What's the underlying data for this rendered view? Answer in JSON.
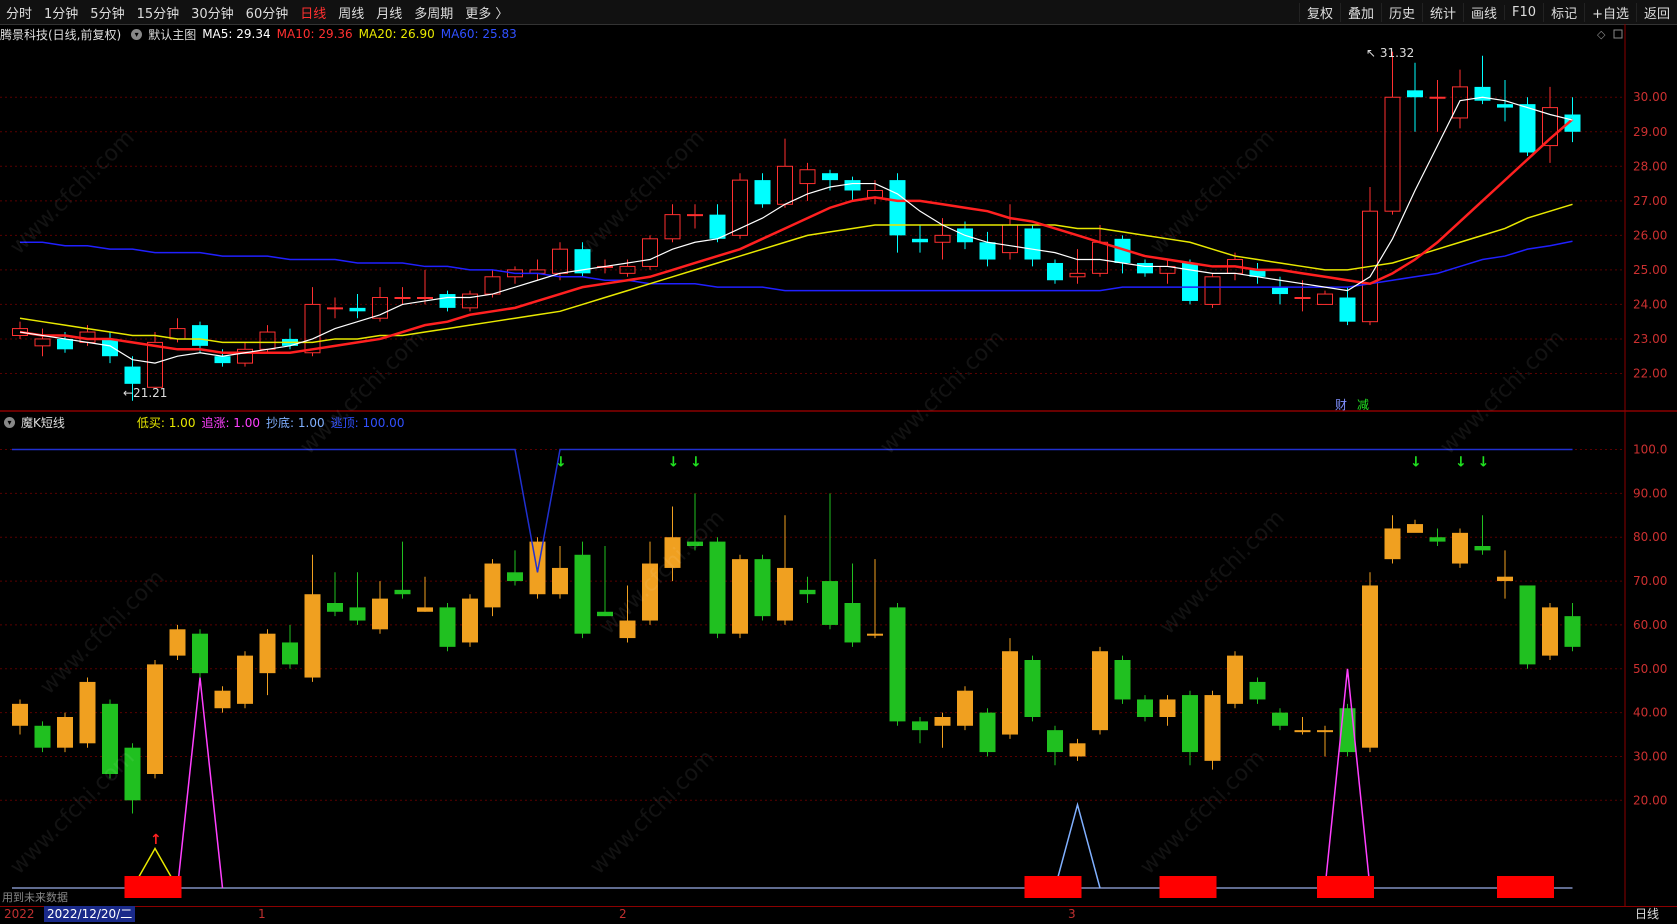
{
  "toolbar": {
    "periods": [
      "分时",
      "1分钟",
      "5分钟",
      "15分钟",
      "30分钟",
      "60分钟",
      "日线",
      "周线",
      "月线",
      "多周期",
      "更多 〉"
    ],
    "active_period": "日线",
    "right_items": [
      "复权",
      "叠加",
      "历史",
      "统计",
      "画线",
      "F10",
      "标记",
      "+自选",
      "返回"
    ]
  },
  "main_info": {
    "stock": "腾景科技(日线,前复权)",
    "template": "默认主图",
    "ma5": "MA5: 29.34",
    "ma10": "MA10: 29.36",
    "ma20": "MA20: 26.90",
    "ma60": "MA60: 25.83"
  },
  "sub_info": {
    "name": "魔K短线",
    "low_buy": "低买: 1.00",
    "chase": "追涨: 1.00",
    "bottom": "抄底: 1.00",
    "top": "逃顶: 100.00"
  },
  "price_axis": [
    "30.00",
    "29.00",
    "28.00",
    "27.00",
    "26.00",
    "25.00",
    "24.00",
    "23.00",
    "22.00"
  ],
  "osc_axis": [
    "100.0",
    "90.00",
    "80.00",
    "70.00",
    "60.00",
    "50.00",
    "40.00",
    "30.00",
    "20.00"
  ],
  "annotations": {
    "high": "31.32",
    "low": "21.21",
    "fin": "财",
    "reduce": "减"
  },
  "bottom": {
    "future_note": "用到未来数据",
    "date_left": "2022",
    "date_box": "2022/12/20/二",
    "months": [
      "1",
      "2",
      "3"
    ],
    "period_label": "日线"
  },
  "watermark": "www.cfchi.com",
  "colors": {
    "up": "#ff3030",
    "down": "#00ffff",
    "ma5": "#ffffff",
    "ma10": "#ff2020",
    "ma20": "#e8e800",
    "ma60": "#2020ff",
    "osc_up": "#f0a020",
    "osc_down": "#20c020",
    "top_line": "#2030d0",
    "signal_red": "#ff0000"
  },
  "chart_data": {
    "type": "candlestick",
    "price_candles": [
      {
        "o": 23.1,
        "c": 23.3,
        "h": 23.5,
        "l": 23.0
      },
      {
        "o": 22.8,
        "c": 23.0,
        "h": 23.3,
        "l": 22.5
      },
      {
        "o": 23.0,
        "c": 22.7,
        "h": 23.2,
        "l": 22.6
      },
      {
        "o": 22.9,
        "c": 23.2,
        "h": 23.4,
        "l": 22.8
      },
      {
        "o": 23.0,
        "c": 22.5,
        "h": 23.2,
        "l": 22.3
      },
      {
        "o": 22.2,
        "c": 21.7,
        "h": 22.5,
        "l": 21.21
      },
      {
        "o": 21.6,
        "c": 22.9,
        "h": 23.2,
        "l": 21.6
      },
      {
        "o": 23.0,
        "c": 23.3,
        "h": 23.6,
        "l": 22.9
      },
      {
        "o": 23.4,
        "c": 22.8,
        "h": 23.5,
        "l": 22.6
      },
      {
        "o": 22.5,
        "c": 22.3,
        "h": 22.7,
        "l": 22.2
      },
      {
        "o": 22.3,
        "c": 22.7,
        "h": 22.9,
        "l": 22.2
      },
      {
        "o": 22.7,
        "c": 23.2,
        "h": 23.4,
        "l": 22.6
      },
      {
        "o": 23.0,
        "c": 22.8,
        "h": 23.3,
        "l": 22.7
      },
      {
        "o": 22.6,
        "c": 24.0,
        "h": 24.5,
        "l": 22.5
      },
      {
        "o": 23.9,
        "c": 23.9,
        "h": 24.2,
        "l": 23.6
      },
      {
        "o": 23.9,
        "c": 23.8,
        "h": 24.3,
        "l": 23.6
      },
      {
        "o": 23.6,
        "c": 24.2,
        "h": 24.5,
        "l": 23.5
      },
      {
        "o": 24.2,
        "c": 24.2,
        "h": 24.5,
        "l": 24.0
      },
      {
        "o": 24.2,
        "c": 24.2,
        "h": 25.0,
        "l": 24.0
      },
      {
        "o": 24.3,
        "c": 23.9,
        "h": 24.4,
        "l": 23.8
      },
      {
        "o": 23.9,
        "c": 24.3,
        "h": 24.4,
        "l": 23.8
      },
      {
        "o": 24.3,
        "c": 24.8,
        "h": 25.0,
        "l": 24.2
      },
      {
        "o": 24.8,
        "c": 25.0,
        "h": 25.1,
        "l": 24.6
      },
      {
        "o": 24.9,
        "c": 25.0,
        "h": 25.3,
        "l": 24.7
      },
      {
        "o": 24.9,
        "c": 25.6,
        "h": 25.8,
        "l": 24.7
      },
      {
        "o": 25.6,
        "c": 24.9,
        "h": 25.8,
        "l": 24.8
      },
      {
        "o": 25.1,
        "c": 25.1,
        "h": 25.3,
        "l": 24.9
      },
      {
        "o": 24.9,
        "c": 25.1,
        "h": 25.3,
        "l": 24.8
      },
      {
        "o": 25.1,
        "c": 25.9,
        "h": 26.0,
        "l": 25.0
      },
      {
        "o": 25.9,
        "c": 26.6,
        "h": 26.9,
        "l": 25.8
      },
      {
        "o": 26.6,
        "c": 26.6,
        "h": 26.9,
        "l": 26.2
      },
      {
        "o": 26.6,
        "c": 25.9,
        "h": 26.9,
        "l": 25.8
      },
      {
        "o": 26.0,
        "c": 27.6,
        "h": 27.8,
        "l": 25.9
      },
      {
        "o": 27.6,
        "c": 26.9,
        "h": 27.8,
        "l": 26.8
      },
      {
        "o": 26.9,
        "c": 28.0,
        "h": 28.8,
        "l": 26.8
      },
      {
        "o": 27.5,
        "c": 27.9,
        "h": 28.1,
        "l": 27.0
      },
      {
        "o": 27.8,
        "c": 27.6,
        "h": 27.9,
        "l": 27.3
      },
      {
        "o": 27.6,
        "c": 27.3,
        "h": 27.7,
        "l": 27.0
      },
      {
        "o": 27.1,
        "c": 27.3,
        "h": 27.6,
        "l": 26.9
      },
      {
        "o": 27.6,
        "c": 26.0,
        "h": 27.8,
        "l": 25.5
      },
      {
        "o": 25.9,
        "c": 25.8,
        "h": 26.3,
        "l": 25.5
      },
      {
        "o": 25.8,
        "c": 26.0,
        "h": 26.5,
        "l": 25.3
      },
      {
        "o": 26.2,
        "c": 25.8,
        "h": 26.4,
        "l": 25.6
      },
      {
        "o": 25.8,
        "c": 25.3,
        "h": 26.1,
        "l": 25.1
      },
      {
        "o": 25.5,
        "c": 26.3,
        "h": 26.9,
        "l": 25.3
      },
      {
        "o": 26.2,
        "c": 25.3,
        "h": 26.3,
        "l": 25.1
      },
      {
        "o": 25.2,
        "c": 24.7,
        "h": 25.3,
        "l": 24.6
      },
      {
        "o": 24.8,
        "c": 24.9,
        "h": 25.6,
        "l": 24.6
      },
      {
        "o": 24.9,
        "c": 25.8,
        "h": 26.3,
        "l": 24.8
      },
      {
        "o": 25.9,
        "c": 25.2,
        "h": 26.0,
        "l": 24.9
      },
      {
        "o": 25.2,
        "c": 24.9,
        "h": 25.3,
        "l": 24.8
      },
      {
        "o": 24.9,
        "c": 25.1,
        "h": 25.3,
        "l": 24.6
      },
      {
        "o": 25.2,
        "c": 24.1,
        "h": 25.3,
        "l": 24.0
      },
      {
        "o": 24.0,
        "c": 24.8,
        "h": 24.9,
        "l": 23.9
      },
      {
        "o": 24.9,
        "c": 25.3,
        "h": 25.5,
        "l": 24.7
      },
      {
        "o": 25.0,
        "c": 24.8,
        "h": 25.2,
        "l": 24.6
      },
      {
        "o": 24.5,
        "c": 24.3,
        "h": 24.8,
        "l": 24.0
      },
      {
        "o": 24.2,
        "c": 24.2,
        "h": 24.7,
        "l": 23.8
      },
      {
        "o": 24.0,
        "c": 24.3,
        "h": 24.4,
        "l": 24.0
      },
      {
        "o": 24.2,
        "c": 23.5,
        "h": 24.5,
        "l": 23.4
      },
      {
        "o": 23.5,
        "c": 26.7,
        "h": 27.4,
        "l": 23.4
      },
      {
        "o": 26.7,
        "c": 30.0,
        "h": 31.32,
        "l": 26.6
      },
      {
        "o": 30.2,
        "c": 30.0,
        "h": 31.0,
        "l": 29.0
      },
      {
        "o": 30.0,
        "c": 30.0,
        "h": 30.5,
        "l": 29.0
      },
      {
        "o": 29.4,
        "c": 30.3,
        "h": 30.8,
        "l": 29.1
      },
      {
        "o": 30.3,
        "c": 29.9,
        "h": 31.2,
        "l": 29.8
      },
      {
        "o": 29.8,
        "c": 29.7,
        "h": 30.5,
        "l": 29.3
      },
      {
        "o": 29.8,
        "c": 28.4,
        "h": 30.0,
        "l": 28.3
      },
      {
        "o": 28.6,
        "c": 29.7,
        "h": 30.3,
        "l": 28.1
      },
      {
        "o": 29.5,
        "c": 29.0,
        "h": 30.0,
        "l": 28.7
      }
    ],
    "ma5": [
      23.2,
      23.1,
      23.0,
      22.9,
      22.8,
      22.4,
      22.3,
      22.5,
      22.6,
      22.5,
      22.6,
      22.7,
      22.8,
      23.0,
      23.3,
      23.5,
      23.7,
      24.0,
      24.1,
      24.2,
      24.2,
      24.3,
      24.5,
      24.7,
      24.9,
      25.0,
      25.1,
      25.2,
      25.3,
      25.6,
      25.8,
      25.9,
      26.2,
      26.5,
      26.9,
      27.2,
      27.4,
      27.5,
      27.5,
      27.2,
      26.7,
      26.3,
      26.0,
      25.8,
      25.7,
      25.6,
      25.5,
      25.3,
      25.3,
      25.2,
      25.1,
      25.1,
      25.0,
      24.9,
      24.9,
      24.8,
      24.7,
      24.6,
      24.5,
      24.4,
      24.8,
      25.9,
      27.3,
      28.6,
      29.9,
      30.0,
      29.9,
      29.7,
      29.5,
      29.34
    ],
    "ma10": [
      23.2,
      23.1,
      23.1,
      23.0,
      23.0,
      22.9,
      22.8,
      22.7,
      22.7,
      22.6,
      22.6,
      22.6,
      22.6,
      22.7,
      22.8,
      22.9,
      23.0,
      23.2,
      23.4,
      23.5,
      23.7,
      23.8,
      23.9,
      24.1,
      24.3,
      24.5,
      24.6,
      24.7,
      24.8,
      25.0,
      25.2,
      25.4,
      25.6,
      25.9,
      26.2,
      26.5,
      26.8,
      27.0,
      27.1,
      27.0,
      27.0,
      26.9,
      26.8,
      26.7,
      26.5,
      26.4,
      26.2,
      26.0,
      25.8,
      25.6,
      25.4,
      25.3,
      25.2,
      25.1,
      25.1,
      25.0,
      25.0,
      24.9,
      24.8,
      24.7,
      24.6,
      24.9,
      25.3,
      25.8,
      26.4,
      27.0,
      27.6,
      28.2,
      28.8,
      29.36
    ],
    "ma20": [
      23.6,
      23.5,
      23.4,
      23.3,
      23.2,
      23.1,
      23.1,
      23.0,
      23.0,
      22.9,
      22.9,
      22.9,
      22.9,
      22.9,
      23.0,
      23.0,
      23.1,
      23.1,
      23.2,
      23.3,
      23.4,
      23.5,
      23.6,
      23.7,
      23.8,
      24.0,
      24.2,
      24.4,
      24.6,
      24.8,
      25.0,
      25.2,
      25.4,
      25.6,
      25.8,
      26.0,
      26.1,
      26.2,
      26.3,
      26.3,
      26.3,
      26.3,
      26.3,
      26.3,
      26.3,
      26.3,
      26.3,
      26.2,
      26.2,
      26.1,
      26.0,
      25.9,
      25.8,
      25.6,
      25.4,
      25.3,
      25.2,
      25.1,
      25.0,
      25.0,
      25.1,
      25.2,
      25.4,
      25.6,
      25.8,
      26.0,
      26.2,
      26.5,
      26.7,
      26.9
    ],
    "ma60": [
      25.8,
      25.8,
      25.7,
      25.7,
      25.6,
      25.6,
      25.5,
      25.5,
      25.5,
      25.4,
      25.4,
      25.4,
      25.3,
      25.3,
      25.3,
      25.2,
      25.2,
      25.2,
      25.1,
      25.1,
      25.0,
      25.0,
      24.9,
      24.9,
      24.8,
      24.8,
      24.7,
      24.7,
      24.6,
      24.6,
      24.6,
      24.5,
      24.5,
      24.5,
      24.4,
      24.4,
      24.4,
      24.4,
      24.4,
      24.4,
      24.4,
      24.4,
      24.4,
      24.4,
      24.4,
      24.4,
      24.4,
      24.4,
      24.4,
      24.5,
      24.5,
      24.5,
      24.5,
      24.5,
      24.5,
      24.5,
      24.5,
      24.5,
      24.5,
      24.5,
      24.6,
      24.7,
      24.8,
      24.9,
      25.1,
      25.3,
      25.4,
      25.6,
      25.7,
      25.83
    ],
    "osc_candles": [
      {
        "o": 37,
        "c": 42,
        "h": 43,
        "l": 35
      },
      {
        "o": 37,
        "c": 32,
        "h": 38,
        "l": 31
      },
      {
        "o": 32,
        "c": 39,
        "h": 40,
        "l": 31
      },
      {
        "o": 33,
        "c": 47,
        "h": 48,
        "l": 32
      },
      {
        "o": 42,
        "c": 26,
        "h": 43,
        "l": 25
      },
      {
        "o": 32,
        "c": 20,
        "h": 33,
        "l": 17
      },
      {
        "o": 26,
        "c": 51,
        "h": 52,
        "l": 25
      },
      {
        "o": 53,
        "c": 59,
        "h": 60,
        "l": 52
      },
      {
        "o": 58,
        "c": 49,
        "h": 59,
        "l": 48
      },
      {
        "o": 41,
        "c": 45,
        "h": 46,
        "l": 40
      },
      {
        "o": 42,
        "c": 53,
        "h": 54,
        "l": 41
      },
      {
        "o": 49,
        "c": 58,
        "h": 59,
        "l": 44
      },
      {
        "o": 56,
        "c": 51,
        "h": 60,
        "l": 50
      },
      {
        "o": 48,
        "c": 67,
        "h": 76,
        "l": 47
      },
      {
        "o": 65,
        "c": 63,
        "h": 72,
        "l": 62
      },
      {
        "o": 64,
        "c": 61,
        "h": 72,
        "l": 60
      },
      {
        "o": 59,
        "c": 66,
        "h": 70,
        "l": 58
      },
      {
        "o": 68,
        "c": 67,
        "h": 79,
        "l": 66
      },
      {
        "o": 63,
        "c": 64,
        "h": 71,
        "l": 63
      },
      {
        "o": 64,
        "c": 55,
        "h": 65,
        "l": 54
      },
      {
        "o": 56,
        "c": 66,
        "h": 67,
        "l": 55
      },
      {
        "o": 64,
        "c": 74,
        "h": 75,
        "l": 62
      },
      {
        "o": 72,
        "c": 70,
        "h": 77,
        "l": 69
      },
      {
        "o": 67,
        "c": 79,
        "h": 80,
        "l": 66
      },
      {
        "o": 67,
        "c": 73,
        "h": 78,
        "l": 66
      },
      {
        "o": 76,
        "c": 58,
        "h": 79,
        "l": 57
      },
      {
        "o": 63,
        "c": 62,
        "h": 78,
        "l": 62
      },
      {
        "o": 57,
        "c": 61,
        "h": 69,
        "l": 56
      },
      {
        "o": 61,
        "c": 74,
        "h": 79,
        "l": 60
      },
      {
        "o": 73,
        "c": 80,
        "h": 87,
        "l": 70
      },
      {
        "o": 79,
        "c": 78,
        "h": 90,
        "l": 77
      },
      {
        "o": 79,
        "c": 58,
        "h": 80,
        "l": 57
      },
      {
        "o": 58,
        "c": 75,
        "h": 76,
        "l": 57
      },
      {
        "o": 75,
        "c": 62,
        "h": 76,
        "l": 61
      },
      {
        "o": 61,
        "c": 73,
        "h": 85,
        "l": 60
      },
      {
        "o": 68,
        "c": 67,
        "h": 71,
        "l": 65
      },
      {
        "o": 70,
        "c": 60,
        "h": 90,
        "l": 59
      },
      {
        "o": 65,
        "c": 56,
        "h": 74,
        "l": 55
      },
      {
        "o": 58,
        "c": 58,
        "h": 75,
        "l": 57
      },
      {
        "o": 64,
        "c": 38,
        "h": 65,
        "l": 37
      },
      {
        "o": 38,
        "c": 36,
        "h": 39,
        "l": 33
      },
      {
        "o": 37,
        "c": 39,
        "h": 40,
        "l": 32
      },
      {
        "o": 37,
        "c": 45,
        "h": 46,
        "l": 36
      },
      {
        "o": 40,
        "c": 31,
        "h": 41,
        "l": 30
      },
      {
        "o": 35,
        "c": 54,
        "h": 57,
        "l": 34
      },
      {
        "o": 52,
        "c": 39,
        "h": 53,
        "l": 38
      },
      {
        "o": 36,
        "c": 31,
        "h": 37,
        "l": 28
      },
      {
        "o": 30,
        "c": 33,
        "h": 34,
        "l": 29
      },
      {
        "o": 36,
        "c": 54,
        "h": 55,
        "l": 35
      },
      {
        "o": 52,
        "c": 43,
        "h": 53,
        "l": 42
      },
      {
        "o": 43,
        "c": 39,
        "h": 44,
        "l": 38
      },
      {
        "o": 39,
        "c": 43,
        "h": 44,
        "l": 37
      },
      {
        "o": 44,
        "c": 31,
        "h": 45,
        "l": 28
      },
      {
        "o": 29,
        "c": 44,
        "h": 45,
        "l": 27
      },
      {
        "o": 42,
        "c": 53,
        "h": 54,
        "l": 41
      },
      {
        "o": 47,
        "c": 43,
        "h": 48,
        "l": 42
      },
      {
        "o": 40,
        "c": 37,
        "h": 41,
        "l": 36
      },
      {
        "o": 36,
        "c": 36,
        "h": 39,
        "l": 35
      },
      {
        "o": 36,
        "c": 36,
        "h": 37,
        "l": 30
      },
      {
        "o": 41,
        "c": 31,
        "h": 42,
        "l": 30
      },
      {
        "o": 32,
        "c": 69,
        "h": 72,
        "l": 31
      },
      {
        "o": 75,
        "c": 82,
        "h": 85,
        "l": 74
      },
      {
        "o": 81,
        "c": 83,
        "h": 84,
        "l": 82
      },
      {
        "o": 80,
        "c": 79,
        "h": 82,
        "l": 78
      },
      {
        "o": 74,
        "c": 81,
        "h": 82,
        "l": 73
      },
      {
        "o": 78,
        "c": 77,
        "h": 85,
        "l": 76
      },
      {
        "o": 70,
        "c": 71,
        "h": 77,
        "l": 66
      },
      {
        "o": 69,
        "c": 51,
        "h": 69,
        "l": 50
      },
      {
        "o": 53,
        "c": 64,
        "h": 65,
        "l": 52
      },
      {
        "o": 62,
        "c": 55,
        "h": 65,
        "l": 54
      }
    ],
    "top_line": {
      "value": 100,
      "dip_index": 23,
      "dip_value": 72
    },
    "low_buy_spike": {
      "index": 6,
      "value": 9
    },
    "chase_spikes": [
      {
        "index": 8,
        "value": 48
      },
      {
        "index": 59,
        "value": 50
      }
    ],
    "bottom_spike": {
      "index": 47,
      "value": 19
    },
    "green_arrows": [
      24,
      29,
      30,
      62,
      64,
      65
    ],
    "red_arrow": 6,
    "signal_bars": [
      [
        5,
        7
      ],
      [
        45,
        47
      ],
      [
        51,
        53
      ],
      [
        58,
        60
      ],
      [
        66,
        68
      ]
    ],
    "price_range": [
      21.0,
      31.6
    ],
    "osc_range": [
      0,
      104
    ]
  }
}
